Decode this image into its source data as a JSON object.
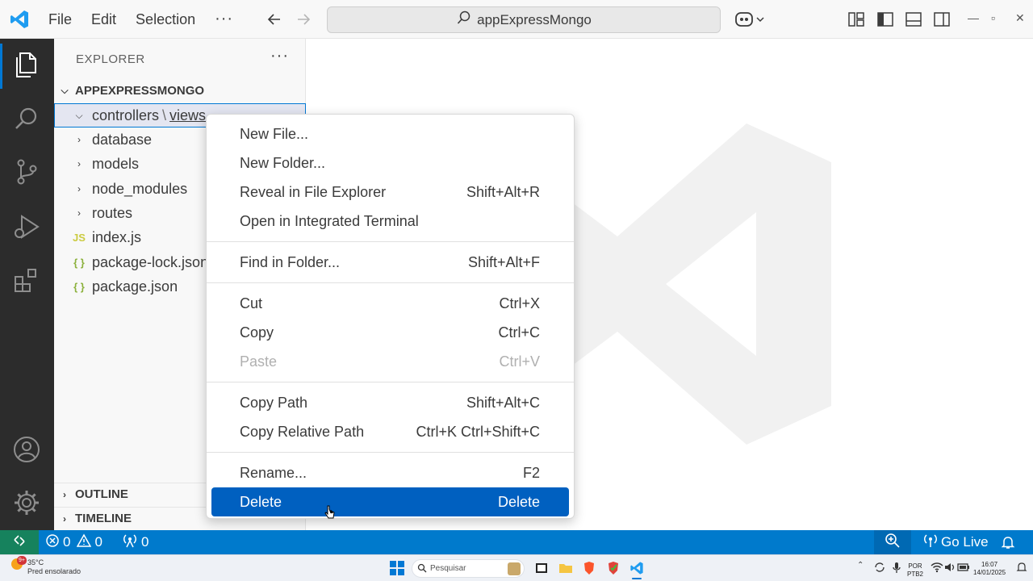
{
  "titlebar": {
    "menu": [
      "File",
      "Edit",
      "Selection"
    ],
    "more": "···",
    "search_text": "appExpressMongo",
    "icons": [
      "vscode-logo-icon",
      "back-arrow-icon",
      "forward-arrow-icon",
      "search-icon",
      "copilot-icon",
      "customize-layout-icon",
      "toggle-primary-sidebar-icon",
      "toggle-panel-icon",
      "toggle-secondary-sidebar-icon",
      "minimize-icon",
      "restore-icon",
      "close-icon"
    ]
  },
  "activitybar": {
    "icons": [
      "explorer-icon",
      "search-icon",
      "source-control-icon",
      "run-debug-icon",
      "extensions-icon",
      "accounts-icon",
      "manage-gear-icon"
    ]
  },
  "sidebar": {
    "header": "EXPLORER",
    "more": "···",
    "root": "APPEXPRESSMONGO",
    "tree": [
      {
        "label_a": "controllers",
        "sep": "\\",
        "label_b": "views",
        "type": "folder",
        "expanded": true,
        "selected": true
      },
      {
        "label": "database",
        "type": "folder"
      },
      {
        "label": "models",
        "type": "folder"
      },
      {
        "label": "node_modules",
        "type": "folder"
      },
      {
        "label": "routes",
        "type": "folder"
      },
      {
        "label": "index.js",
        "type": "js",
        "badge": "JS"
      },
      {
        "label": "package-lock.json",
        "type": "json",
        "badge": "{ }"
      },
      {
        "label": "package.json",
        "type": "json",
        "badge": "{ }"
      }
    ],
    "outline": "OUTLINE",
    "timeline": "TIMELINE"
  },
  "context_menu": {
    "groups": [
      [
        {
          "label": "New File...",
          "key": ""
        },
        {
          "label": "New Folder...",
          "key": ""
        },
        {
          "label": "Reveal in File Explorer",
          "key": "Shift+Alt+R"
        },
        {
          "label": "Open in Integrated Terminal",
          "key": ""
        }
      ],
      [
        {
          "label": "Find in Folder...",
          "key": "Shift+Alt+F"
        }
      ],
      [
        {
          "label": "Cut",
          "key": "Ctrl+X"
        },
        {
          "label": "Copy",
          "key": "Ctrl+C"
        },
        {
          "label": "Paste",
          "key": "Ctrl+V",
          "disabled": true
        }
      ],
      [
        {
          "label": "Copy Path",
          "key": "Shift+Alt+C"
        },
        {
          "label": "Copy Relative Path",
          "key": "Ctrl+K Ctrl+Shift+C"
        }
      ],
      [
        {
          "label": "Rename...",
          "key": "F2"
        },
        {
          "label": "Delete",
          "key": "Delete",
          "active": true
        }
      ]
    ]
  },
  "statusbar": {
    "errors": "0",
    "warnings": "0",
    "ports": "0",
    "go_live": "Go Live",
    "colors": {
      "bar": "#007acc",
      "remote": "#16825d"
    }
  },
  "taskbar": {
    "temp": "35°C",
    "weather": "Pred ensolarado",
    "weather_badge": "9+",
    "search_placeholder": "Pesquisar",
    "lang_a": "POR",
    "lang_b": "PTB2",
    "time": "16:07",
    "date": "14/01/2025"
  }
}
